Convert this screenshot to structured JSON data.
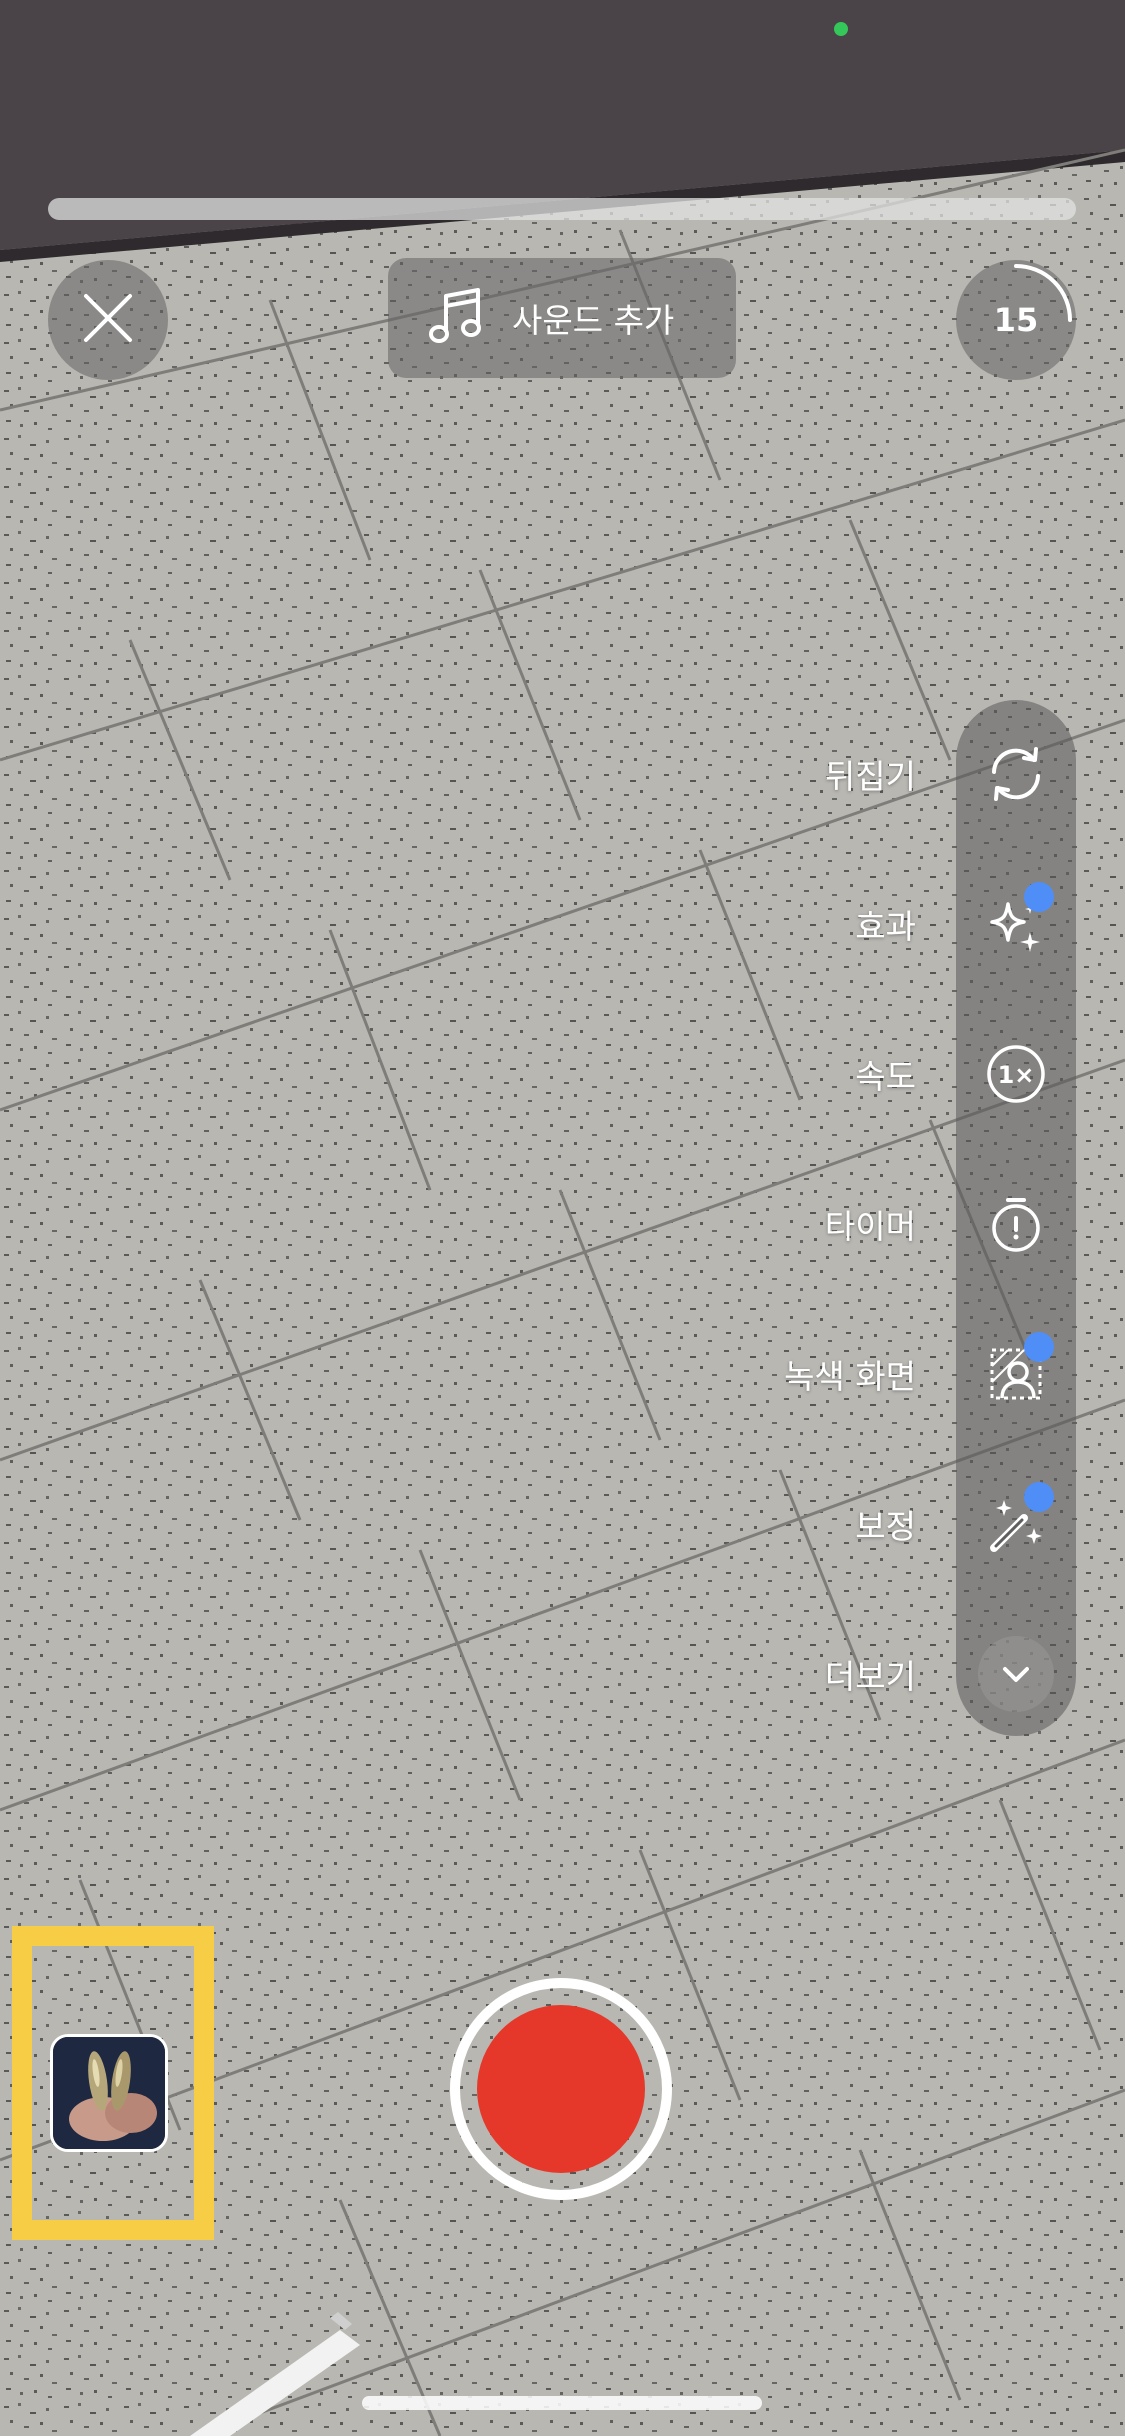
{
  "status_bar": {
    "camera_indicator_color": "#34c759"
  },
  "recording": {
    "progress": 0.0,
    "duration_seconds": "15",
    "record_color": "#e5382a"
  },
  "header": {
    "close_icon": "close-icon",
    "add_sound_label": "사운드 추가",
    "music_icon": "music-note-icon"
  },
  "side_toolbar": {
    "items": [
      {
        "label": "뒤집기",
        "icon": "flip-camera-icon",
        "badge": false
      },
      {
        "label": "효과",
        "icon": "sparkles-icon",
        "badge": true
      },
      {
        "label": "속도",
        "icon": "speed-1x-icon",
        "badge": false
      },
      {
        "label": "타이머",
        "icon": "timer-icon",
        "badge": false
      },
      {
        "label": "녹색 화면",
        "icon": "green-screen-icon",
        "badge": true
      },
      {
        "label": "보정",
        "icon": "magic-wand-icon",
        "badge": true
      },
      {
        "label": "더보기",
        "icon": "chevron-down-icon",
        "badge": false
      }
    ],
    "badge_color": "#4f8ef7"
  },
  "gallery": {
    "highlight_color": "#f7cd46"
  }
}
